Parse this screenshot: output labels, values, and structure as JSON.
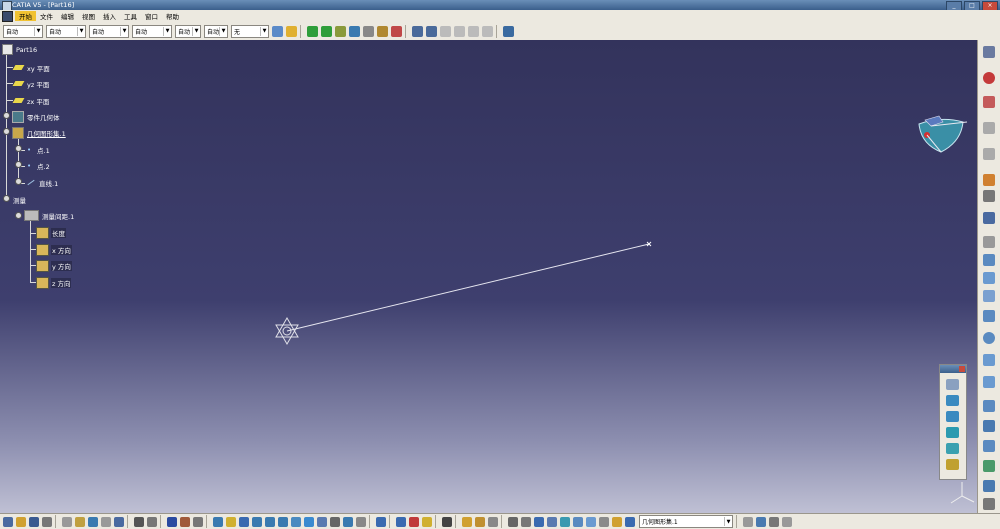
{
  "window": {
    "title": "CATIA V5 - [Part16]",
    "buttons": [
      "_",
      "□",
      "×"
    ]
  },
  "menu": {
    "items": [
      "开始",
      "文件",
      "编辑",
      "视图",
      "插入",
      "工具",
      "窗口",
      "帮助"
    ],
    "active": "开始"
  },
  "toolbar": {
    "dropdowns": [
      {
        "value": "自动",
        "width": 38
      },
      {
        "value": "自动",
        "width": 38
      },
      {
        "value": "自动",
        "width": 38
      },
      {
        "value": "自动",
        "width": 38
      },
      {
        "value": "自动",
        "width": 24
      },
      {
        "value": "自动",
        "width": 22
      },
      {
        "value": "无",
        "width": 36
      }
    ]
  },
  "tree": {
    "root": "Part16",
    "planes": [
      "xy 平面",
      "yz 平面",
      "zx 平面"
    ],
    "body": "零件几何体",
    "geometrical_set": "几何图形集.1",
    "geo_children": [
      "点.1",
      "点.2",
      "直线.1"
    ],
    "measure": "测量",
    "measure_group": "测量间距.1",
    "measure_children": [
      "长度",
      "x 方向",
      "y 方向",
      "z 方向"
    ]
  },
  "status": {
    "active_set": "几何图形集.1"
  },
  "colors": {
    "accent_menu": "#f1c232",
    "viewport_top": "#33335c",
    "viewport_bottom": "#bfc0d4",
    "line": "#e6e6f0"
  }
}
